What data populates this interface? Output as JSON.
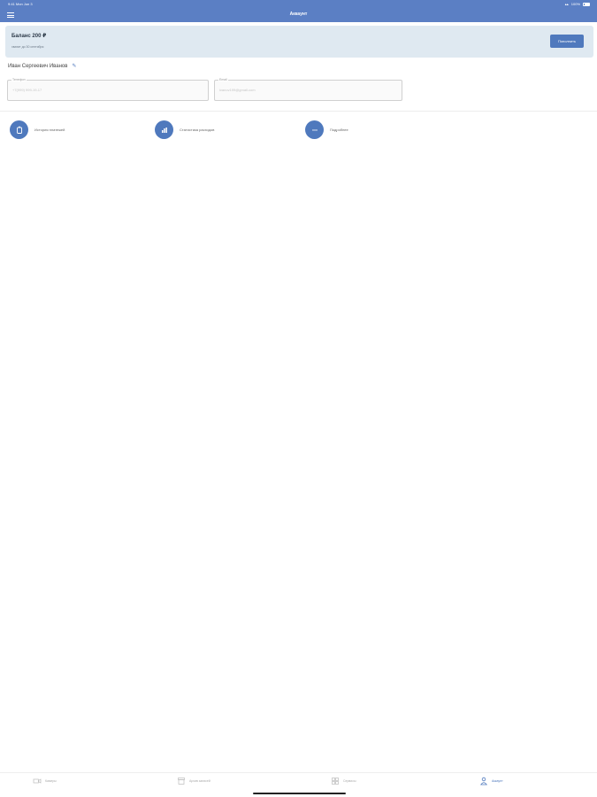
{
  "status_bar": {
    "time_date": "9:41 Mon Jun 3",
    "battery": "100%"
  },
  "header": {
    "title": "Аккаунт"
  },
  "balance": {
    "title": "Баланс 200 ₽",
    "subtitle": "хватит до 30 сентября",
    "topup_label": "Пополнить"
  },
  "profile": {
    "name": "Иван Сергеевич Иванов"
  },
  "fields": {
    "phone": {
      "label": "Телефон",
      "value": "+7(999) 999-19-17"
    },
    "email": {
      "label": "Email",
      "value": "ivanov199@gmail.com"
    }
  },
  "actions": [
    {
      "label": "История платежей",
      "icon": "wallet-icon"
    },
    {
      "label": "Статистика расходов",
      "icon": "bar-chart-icon"
    },
    {
      "label": "Подробнее",
      "icon": "more-icon"
    }
  ],
  "tabs": [
    {
      "label": "Камеры",
      "icon": "camera-icon"
    },
    {
      "label": "Архив записей",
      "icon": "archive-icon"
    },
    {
      "label": "Сервисы",
      "icon": "grid-icon"
    },
    {
      "label": "Аккаунт",
      "icon": "user-icon",
      "active": true
    }
  ],
  "colors": {
    "primary": "#5b7fc4",
    "accent": "#4f79bd",
    "card_bg": "#dfe9f1"
  }
}
